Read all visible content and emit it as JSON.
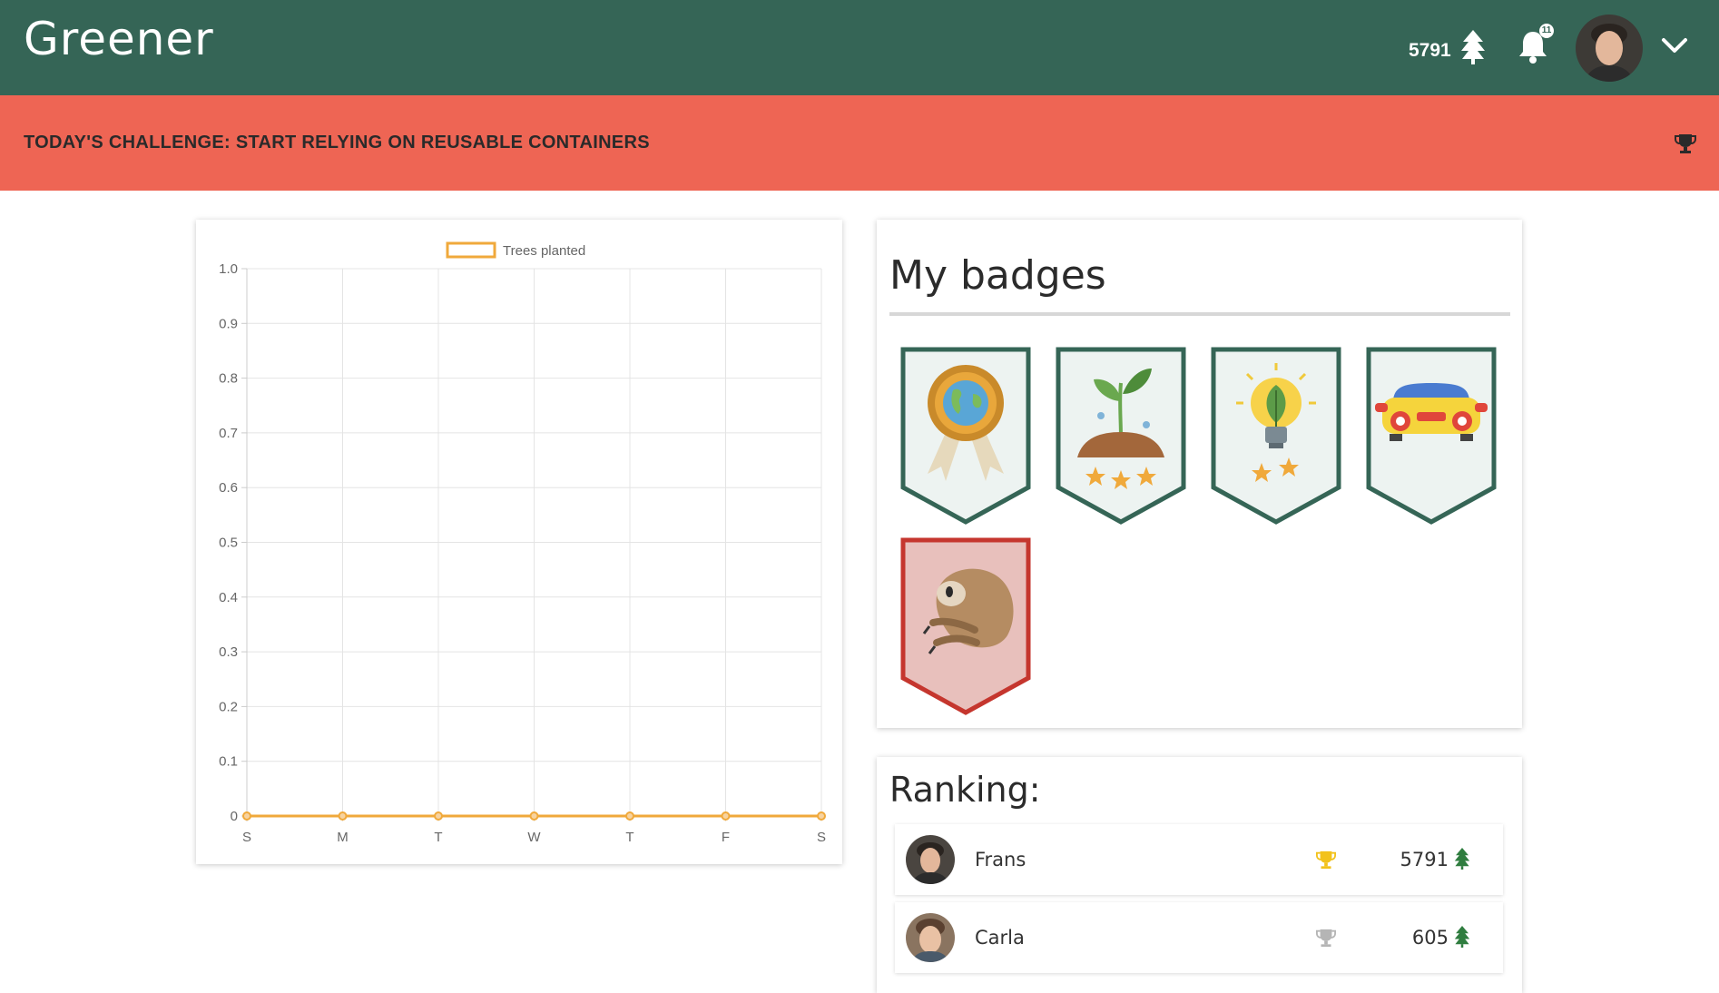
{
  "header": {
    "brand": "Greener",
    "score": "5791",
    "notifications": "11",
    "colors": {
      "bar": "#356556",
      "challenge": "#ee6554"
    }
  },
  "challenge": {
    "text": "TODAY'S CHALLENGE: START RELYING ON REUSABLE CONTAINERS"
  },
  "chart_data": {
    "type": "line",
    "legend": [
      "Trees planted"
    ],
    "legend_position": "top",
    "categories": [
      "S",
      "M",
      "T",
      "W",
      "T",
      "F",
      "S"
    ],
    "series": [
      {
        "name": "Trees planted",
        "values": [
          0,
          0,
          0,
          0,
          0,
          0,
          0
        ],
        "color": "#f0a93b"
      }
    ],
    "yticks": [
      "0",
      "0.1",
      "0.2",
      "0.3",
      "0.4",
      "0.5",
      "0.6",
      "0.7",
      "0.8",
      "0.9",
      "1.0"
    ],
    "ylim": [
      0,
      1
    ],
    "grid": true
  },
  "badges": {
    "title": "My badges",
    "items": [
      {
        "icon": "globe-award-icon",
        "theme": "green"
      },
      {
        "icon": "sprout-icon",
        "theme": "green"
      },
      {
        "icon": "eco-lightbulb-icon",
        "theme": "green"
      },
      {
        "icon": "car-icon",
        "theme": "green"
      },
      {
        "icon": "sloth-icon",
        "theme": "red"
      }
    ]
  },
  "ranking": {
    "title": "Ranking:",
    "rows": [
      {
        "name": "Frans",
        "score": "5791",
        "trophy": "gold"
      },
      {
        "name": "Carla",
        "score": "605",
        "trophy": "silver"
      }
    ]
  }
}
